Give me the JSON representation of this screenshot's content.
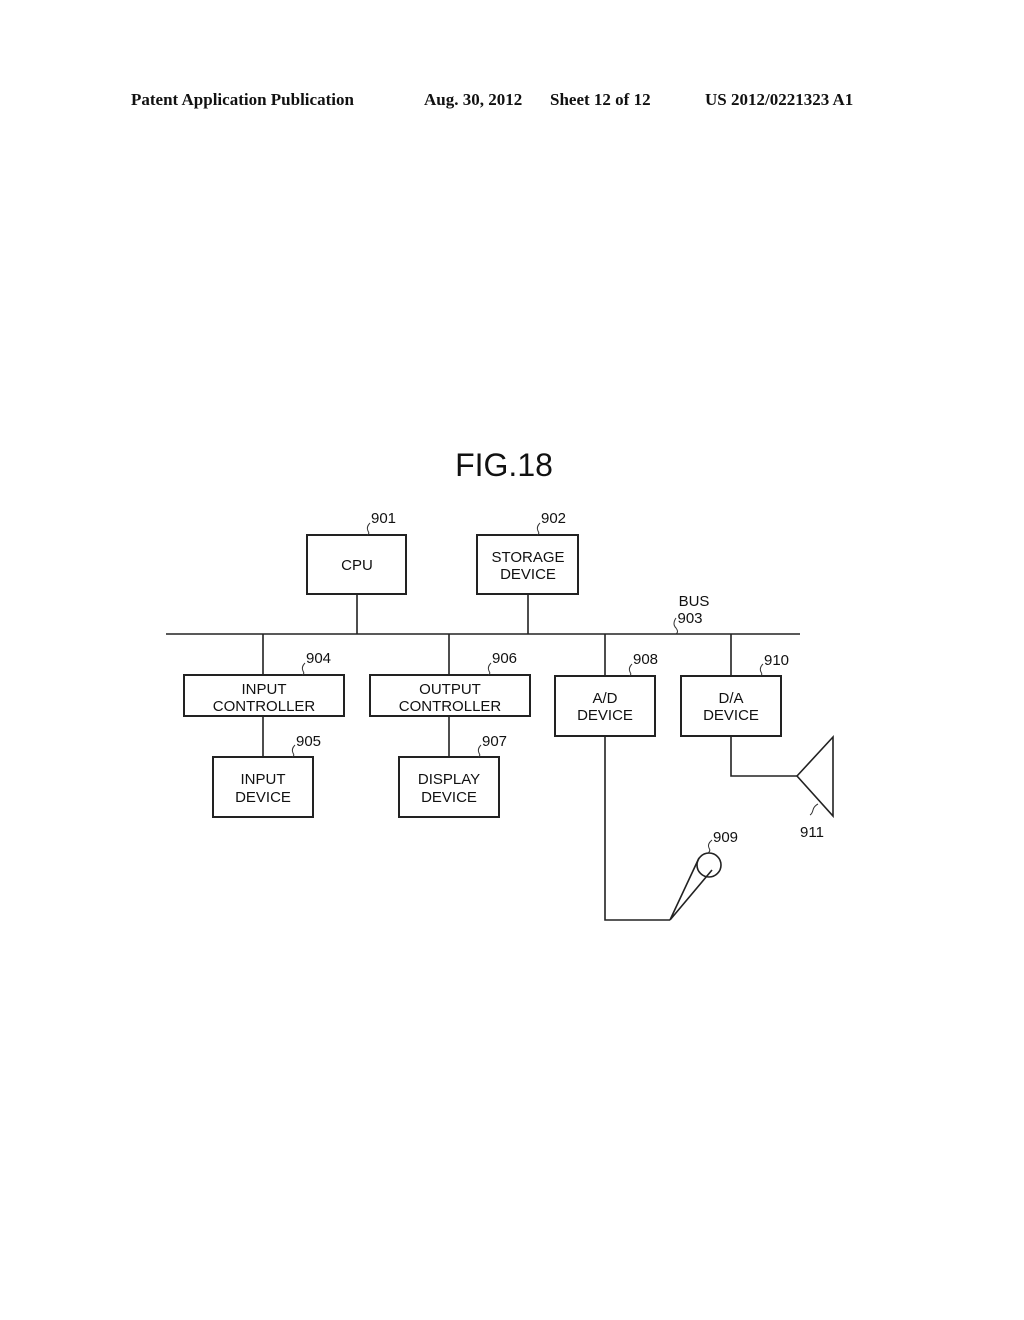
{
  "header": {
    "publication": "Patent Application Publication",
    "date": "Aug. 30, 2012",
    "sheet": "Sheet 12 of 12",
    "number": "US 2012/0221323 A1"
  },
  "figure": {
    "title": "FIG.18",
    "bus": {
      "label": "BUS",
      "ref": "903"
    },
    "blocks": {
      "cpu": {
        "lines": [
          "CPU"
        ],
        "ref": "901"
      },
      "storage": {
        "lines": [
          "STORAGE",
          "DEVICE"
        ],
        "ref": "902"
      },
      "input_controller": {
        "lines": [
          "INPUT",
          "CONTROLLER"
        ],
        "ref": "904"
      },
      "input_device": {
        "lines": [
          "INPUT",
          "DEVICE"
        ],
        "ref": "905"
      },
      "output_controller": {
        "lines": [
          "OUTPUT",
          "CONTROLLER"
        ],
        "ref": "906"
      },
      "display_device": {
        "lines": [
          "DISPLAY",
          "DEVICE"
        ],
        "ref": "907"
      },
      "ad_device": {
        "lines": [
          "A/D",
          "DEVICE"
        ],
        "ref": "908"
      },
      "da_device": {
        "lines": [
          "D/A",
          "DEVICE"
        ],
        "ref": "910"
      }
    },
    "microphone": {
      "ref": "909"
    },
    "speaker": {
      "ref": "911"
    }
  }
}
